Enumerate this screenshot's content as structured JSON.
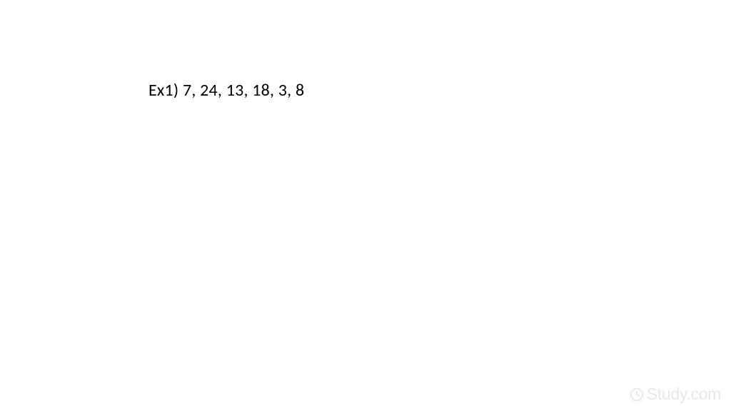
{
  "example": {
    "label": "Ex1)",
    "values": "7, 24, 13, 18, 3, 8"
  },
  "watermark": {
    "text": "Study.com"
  }
}
